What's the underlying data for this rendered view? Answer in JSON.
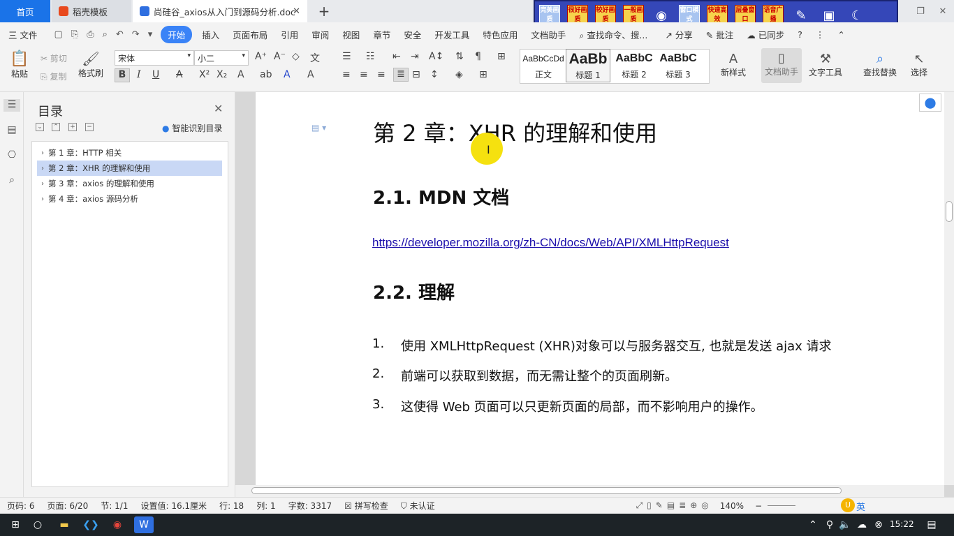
{
  "tabs": {
    "home": "首页",
    "template": "稻壳模板",
    "doc": "尚硅谷_axios从入门到源码分析.doc",
    "close": "✕",
    "add": "+"
  },
  "overlay": {
    "buttons": [
      "完美画质",
      "很好画质",
      "较好画质",
      "一般画质",
      "窗口模式",
      "快速高效",
      "层叠窗口",
      "语音广播"
    ]
  },
  "menubar": {
    "file": "三 文件",
    "items": [
      "开始",
      "插入",
      "页面布局",
      "引用",
      "审阅",
      "视图",
      "章节",
      "安全",
      "开发工具",
      "特色应用",
      "文档助手"
    ],
    "search": "查找命令、搜...",
    "share": "分享",
    "comment": "批注",
    "sync": "已同步"
  },
  "ribbon": {
    "paste": "粘贴",
    "cut": "剪切",
    "copy": "复制",
    "format_painter": "格式刷",
    "font_name": "宋体",
    "font_size": "小二",
    "styles": [
      {
        "sample": "AaBbCcDd",
        "label": "正文"
      },
      {
        "sample": "AaBb",
        "label": "标题 1"
      },
      {
        "sample": "AaBbC",
        "label": "标题 2"
      },
      {
        "sample": "AaBbC",
        "label": "标题 3"
      }
    ],
    "new_style": "新样式",
    "doc_helper": "文档助手",
    "text_tools": "文字工具",
    "find_replace": "查找替换",
    "select": "选择"
  },
  "toc": {
    "title": "目录",
    "smart": "智能识别目录",
    "items": [
      "第 1 章：HTTP 相关",
      "第 2 章：XHR 的理解和使用",
      "第 3 章：axios 的理解和使用",
      "第 4 章：axios 源码分析"
    ]
  },
  "document": {
    "h1": "第 2 章：XHR 的理解和使用",
    "h2_1": "2.1. MDN 文档",
    "link": "https://developer.mozilla.org/zh-CN/docs/Web/API/XMLHttpRequest",
    "h2_2": "2.2.  理解",
    "list": [
      {
        "num": "1.",
        "text": "使用 XMLHttpRequest (XHR)对象可以与服务器交互, 也就是发送 ajax 请求"
      },
      {
        "num": "2.",
        "text": "前端可以获取到数据，而无需让整个的页面刷新。"
      },
      {
        "num": "3.",
        "text": "这使得 Web 页面可以只更新页面的局部，而不影响用户的操作。"
      }
    ]
  },
  "status": {
    "page_num": "页码: 6",
    "pages": "页面: 6/20",
    "section": "节: 1/1",
    "setting": "设置值: 16.1厘米",
    "row": "行: 18",
    "col": "列: 1",
    "words": "字数: 3317",
    "spell": "拼写检查",
    "cert": "未认证",
    "zoom": "140%"
  },
  "taskbar": {
    "clock": "15:22",
    "ime": "英"
  }
}
